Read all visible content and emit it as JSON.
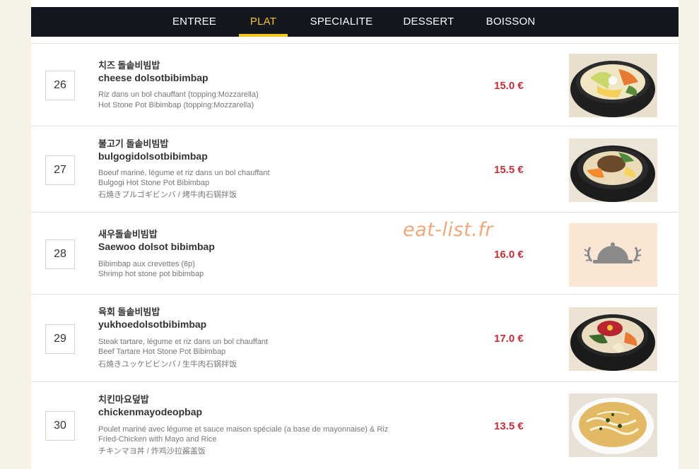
{
  "nav": {
    "tabs": [
      {
        "label": "ENTREE"
      },
      {
        "label": "PLAT"
      },
      {
        "label": "SPECIALITE"
      },
      {
        "label": "DESSERT"
      },
      {
        "label": "BOISSON"
      }
    ],
    "active": "PLAT"
  },
  "watermark": "eat-list.fr",
  "items": [
    {
      "number": "26",
      "name_ko": "치즈 돌솥비빔밥",
      "name_rom": "cheese dolsotbibimbap",
      "desc": [
        "Riz dans un bol chauffant (topping:Mozzarella)",
        "Hot Stone Pot Bibimbap (topping:Mozzarella)"
      ],
      "price": "15.0 €",
      "image": "bibimbap-cheese-photo"
    },
    {
      "number": "27",
      "name_ko": "불고기 돌솥비빔밥",
      "name_rom": "bulgogidolsotbibimbap",
      "desc": [
        "Boeuf mariné, légume et riz dans un bol chauffant",
        "Bulgogi Hot Stone Pot Bibimbap",
        "石焼きプルゴギビンバ / 烤牛肉石锅拌饭"
      ],
      "price": "15.5 €",
      "image": "bibimbap-bulgogi-photo"
    },
    {
      "number": "28",
      "name_ko": "새우돌솥비빔밥",
      "name_rom": "Saewoo dolsot bibimbap",
      "desc": [
        "Bibimbap aux crevettes (6p)",
        "Shrimp hot stone pot bibimbap"
      ],
      "price": "16.0 €",
      "image": "cloche-placeholder-icon"
    },
    {
      "number": "29",
      "name_ko": "육회 돌솥비빔밥",
      "name_rom": "yukhoedolsotbibimbap",
      "desc": [
        "Steak tartare, légume et riz dans un bol chauffant",
        "Beef Tartare Hot Stone Pot Bibimbap",
        "石焼きユッケビビンバ / 生牛肉石锅拌饭"
      ],
      "price": "17.0 €",
      "image": "bibimbap-yukhoe-photo"
    },
    {
      "number": "30",
      "name_ko": "치킨마요덮밥",
      "name_rom": "chickenmayodeopbap",
      "desc": [
        "Poulet mariné avec légume et sauce maison spéciale (a base de mayonnaise) & Riz",
        "Fried-Chicken with Mayo and Rice",
        "チキンマヨ丼 / 炸鸡沙拉酱盖饭"
      ],
      "price": "13.5 €",
      "image": "chicken-mayo-rice-photo"
    }
  ],
  "colors": {
    "navbar": "#13161e",
    "active_tab": "#f5c524",
    "price": "#c0303a",
    "background": "#f7f2e6"
  }
}
